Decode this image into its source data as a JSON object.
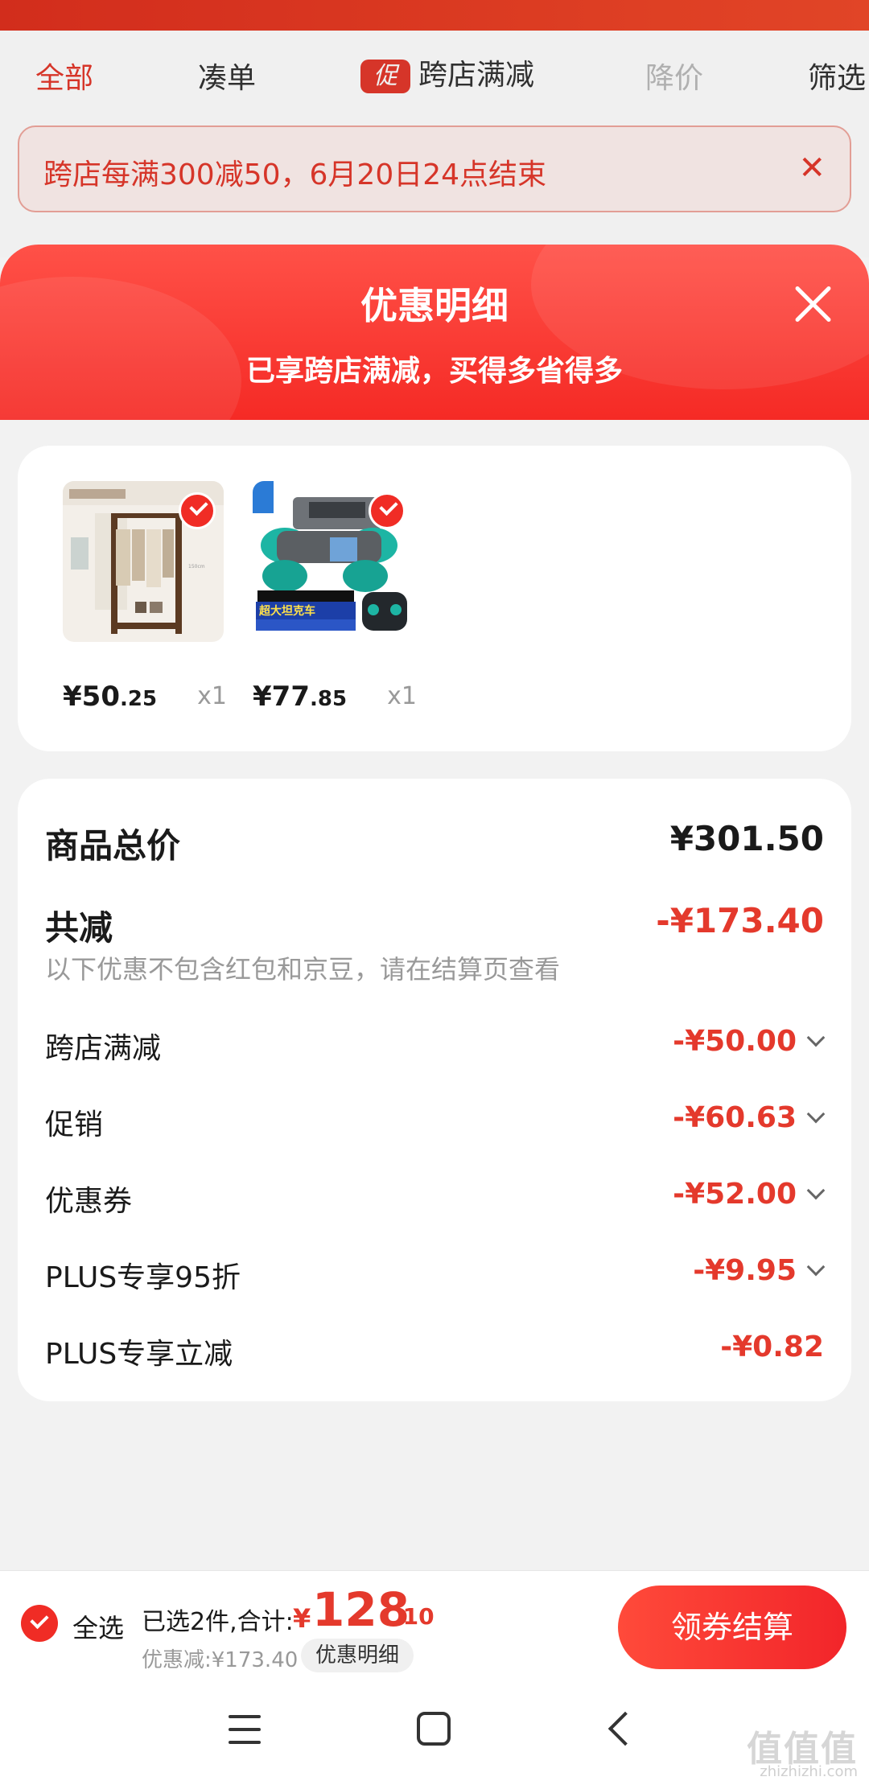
{
  "background_page": {
    "tabs": [
      {
        "label": "全部"
      },
      {
        "label": "凑单"
      },
      {
        "label": "跨店满减",
        "badge": "促"
      },
      {
        "label": "降价"
      },
      {
        "label": "筛选"
      }
    ],
    "notice": {
      "text": "跨店每满300减50，6月20日24点结束",
      "close_icon": "close-icon"
    }
  },
  "sheet": {
    "title": "优惠明细",
    "subtitle": "已享跨店满减，买得多省得多",
    "close_icon": "close-icon"
  },
  "products": [
    {
      "price_main": "¥50",
      "price_cents": ".25",
      "qty": "x1",
      "image_label": "衣帽架",
      "checked": true
    },
    {
      "price_main": "¥77",
      "price_cents": ".85",
      "qty": "x1",
      "image_label": "超大坦克车",
      "checked": true
    }
  ],
  "summary": {
    "total_label": "商品总价",
    "total_value": "¥301.50",
    "reduce_label": "共减",
    "reduce_value": "-¥173.40",
    "note": "以下优惠不包含红包和京豆，请在结算页查看",
    "items": [
      {
        "label": "跨店满减",
        "value": "-¥50.00",
        "expandable": true
      },
      {
        "label": "促销",
        "value": "-¥60.63",
        "expandable": true
      },
      {
        "label": "优惠券",
        "value": "-¥52.00",
        "expandable": true
      },
      {
        "label": "PLUS专享95折",
        "value": "-¥9.95",
        "expandable": true
      },
      {
        "label": "PLUS专享立减",
        "value": "-¥0.82",
        "expandable": false
      }
    ]
  },
  "bottom_bar": {
    "select_all": "全选",
    "selected_text": "已选2件,合计:",
    "currency": "¥",
    "total_int": "128",
    "total_cents": ".10",
    "discount_text": "优惠减:¥173.40",
    "detail_chip": "优惠明细",
    "checkout_label": "领券结算"
  },
  "watermark": {
    "text": "值值值",
    "url": "zhizhizhi.com"
  },
  "colors": {
    "accent": "#e4392c",
    "sheet_header": "#f52a25",
    "background": "#f2f2f2"
  }
}
